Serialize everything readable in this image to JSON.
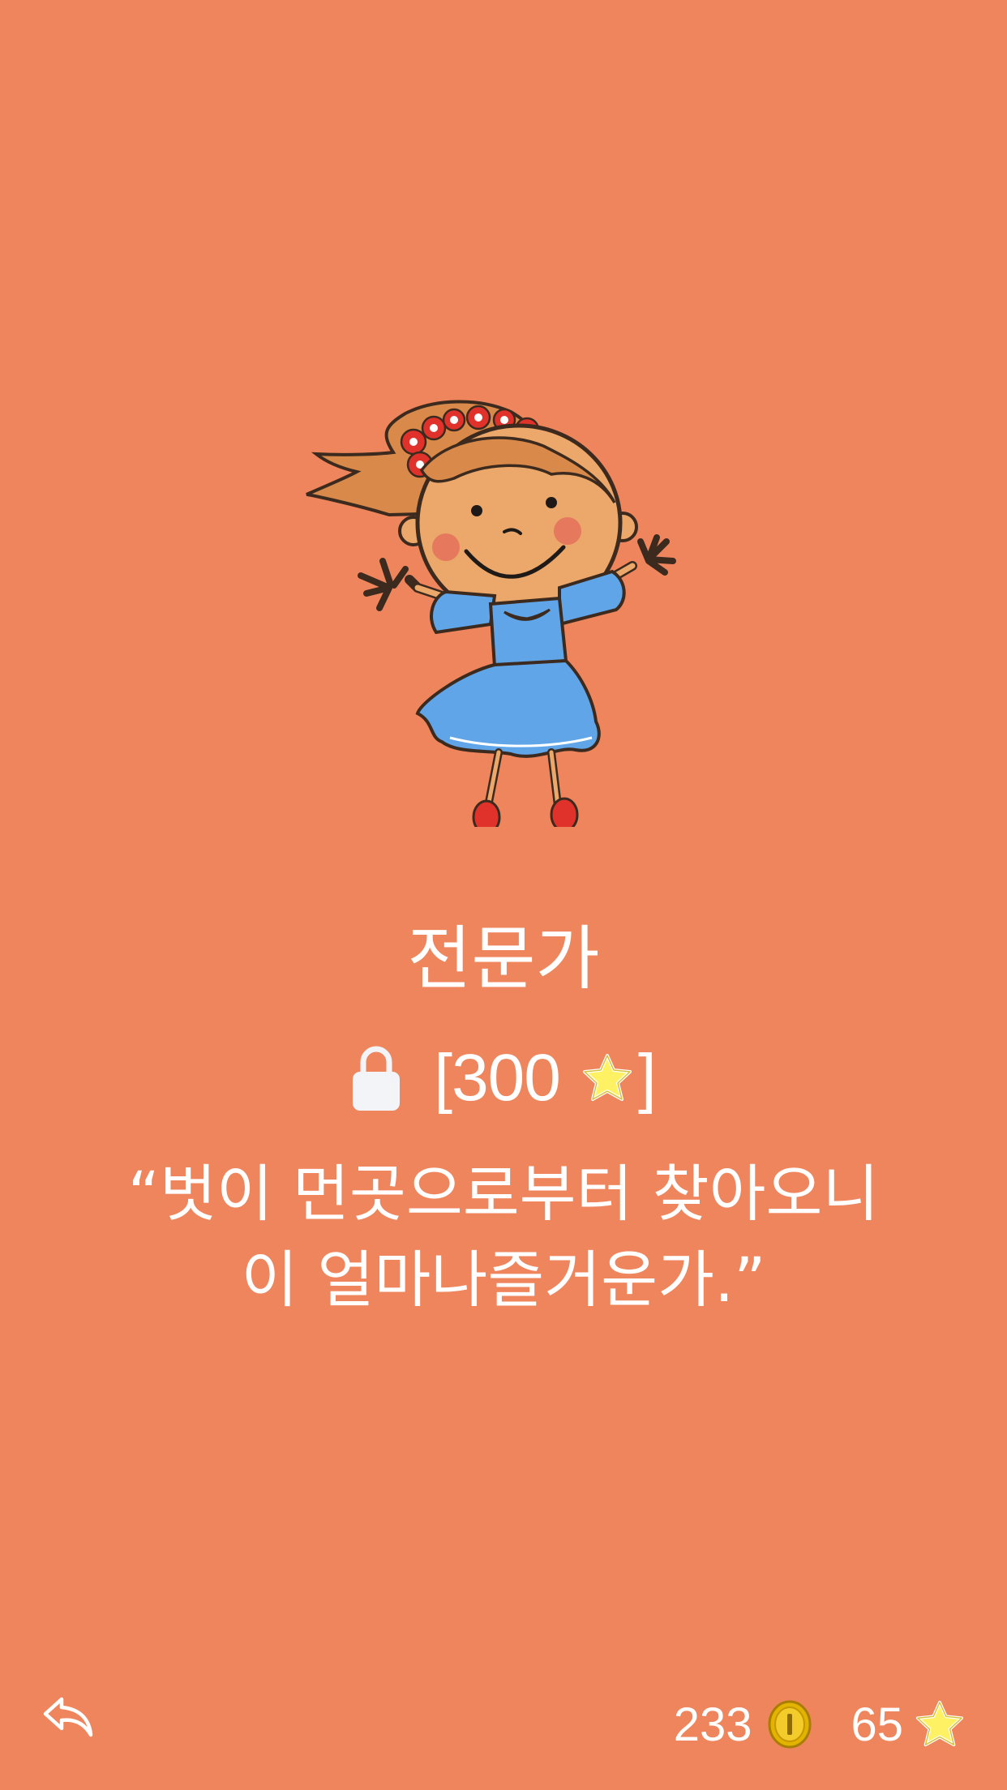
{
  "colors": {
    "background": "#EF855C",
    "text": "#FFFFFF",
    "lock": "#F3F4F8",
    "star": "#FFF164",
    "coin": "#E2B400"
  },
  "character": {
    "icon": "girl-character-illustration"
  },
  "rank": {
    "title": "전문가"
  },
  "unlock": {
    "icon": "lock-icon",
    "open_bracket": "[",
    "cost": "300",
    "currency_icon": "star-icon",
    "close_bracket": "]"
  },
  "quote": {
    "line1": "“벗이 먼곳으로부터 찾아오니",
    "line2": "이 얼마나즐거운가.”"
  },
  "footer": {
    "back_icon": "reply-arrow-icon",
    "coins": "233",
    "coin_icon": "coin-icon",
    "stars": "65",
    "star_icon": "star-icon"
  }
}
